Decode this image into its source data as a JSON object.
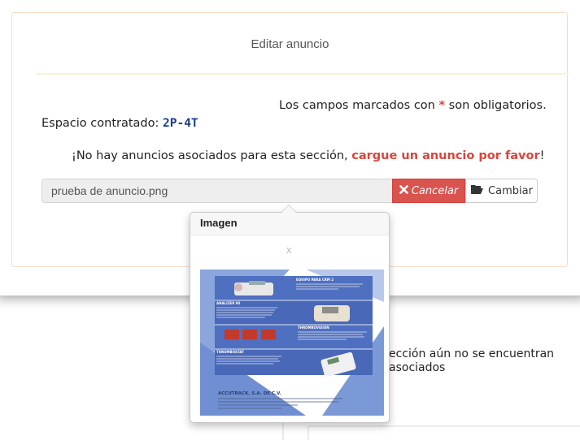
{
  "modal": {
    "title": "Editar anuncio",
    "required_note": {
      "prefix": "Los campos marcados con ",
      "star": "*",
      "suffix": " son obligatorios."
    },
    "espacio": {
      "label": "Espacio contratado: ",
      "code": "2P-4T"
    },
    "no_ads": {
      "prefix": "¡No hay anuncios asociados para esta sección, ",
      "link": "cargue un anuncio por favor",
      "suffix": "!"
    },
    "file_input": {
      "value": "prueba de anuncio.png"
    },
    "cancel_button": {
      "label": "Cancelar",
      "icon": "times-icon"
    },
    "change_button": {
      "label": "Cambiar",
      "icon": "folder-open-icon"
    }
  },
  "popover": {
    "title": "Imagen",
    "close": "x",
    "image": {
      "headings": [
        "EQUIPO PARA CRM 2",
        "ANALIZER 90",
        "THROMBOVISION",
        "THROMBOSTAT"
      ],
      "company": "ACCUTRACK, S.A. DE C.V."
    }
  },
  "background": {
    "line1": "ección aún no se encuentran",
    "line2": "asociados"
  },
  "colors": {
    "danger": "#d9534f",
    "required": "#d9453c",
    "code": "#1a3d8f",
    "panel_border": "#f6dcc8"
  }
}
